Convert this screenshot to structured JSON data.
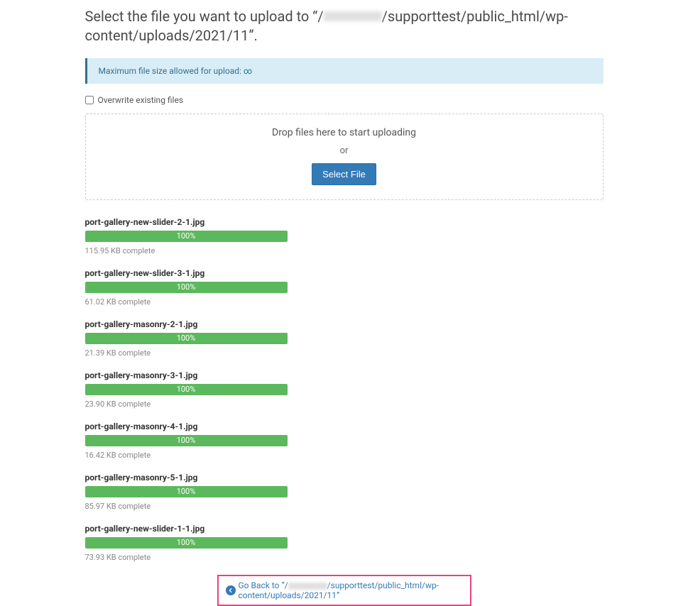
{
  "header": {
    "title_prefix": "Select the file you want to upload to “/",
    "title_suffix": "/supporttest/public_html/wp-content/uploads/2021/11”."
  },
  "info_box": {
    "text": "Maximum file size allowed for upload: ∞"
  },
  "overwrite": {
    "label": "Overwrite existing files"
  },
  "dropzone": {
    "drop_text": "Drop files here to start uploading",
    "or_text": "or",
    "button_label": "Select File"
  },
  "uploads": [
    {
      "filename": "port-gallery-new-slider-2-1.jpg",
      "percent": "100%",
      "status": "115.95 KB complete"
    },
    {
      "filename": "port-gallery-new-slider-3-1.jpg",
      "percent": "100%",
      "status": "61.02 KB complete"
    },
    {
      "filename": "port-gallery-masonry-2-1.jpg",
      "percent": "100%",
      "status": "21.39 KB complete"
    },
    {
      "filename": "port-gallery-masonry-3-1.jpg",
      "percent": "100%",
      "status": "23.90 KB complete"
    },
    {
      "filename": "port-gallery-masonry-4-1.jpg",
      "percent": "100%",
      "status": "16.42 KB complete"
    },
    {
      "filename": "port-gallery-masonry-5-1.jpg",
      "percent": "100%",
      "status": "85.97 KB complete"
    },
    {
      "filename": "port-gallery-new-slider-1-1.jpg",
      "percent": "100%",
      "status": "73.93 KB complete"
    }
  ],
  "goback": {
    "prefix": "Go Back to “/",
    "suffix": "/supporttest/public_html/wp-content/uploads/2021/11”"
  }
}
